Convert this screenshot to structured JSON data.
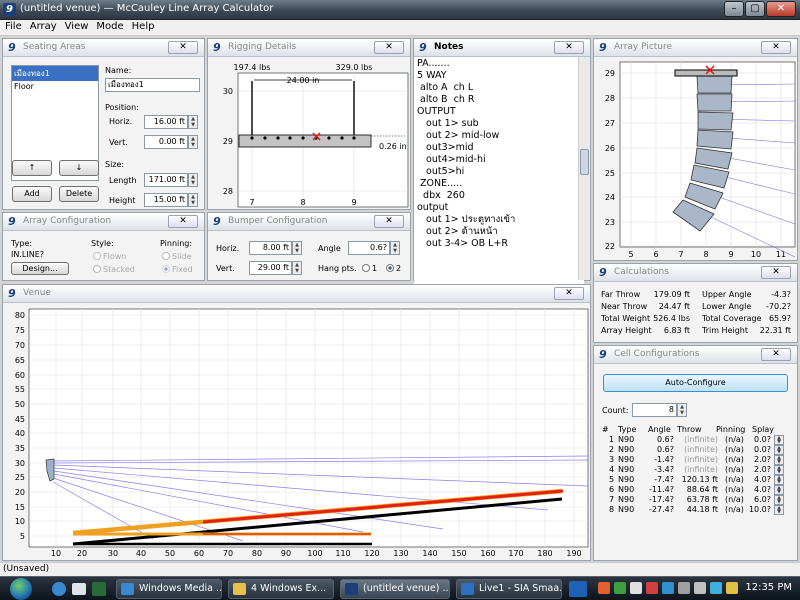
{
  "window": {
    "title": "(untitled venue) — McCauley Line Array Calculator",
    "min_btn": "–",
    "max_btn": "▢",
    "close_btn": "✕"
  },
  "menu": [
    "File",
    "Array",
    "View",
    "Mode",
    "Help"
  ],
  "panel_badge": "9",
  "panel_close": "✕",
  "seating": {
    "title": "Seating Areas",
    "areas": [
      "เมืองทอง1",
      "Floor"
    ],
    "name_label": "Name:",
    "name_value": "เมืองทอง1",
    "position_label": "Position:",
    "horiz_label": "Horiz.",
    "horiz_value": "16.00 ft",
    "vert_label": "Vert.",
    "vert_value": "0.00 ft",
    "size_label": "Size:",
    "length_label": "Length",
    "length_value": "171.00 ft",
    "height_label": "Height",
    "height_value": "15.00 ft",
    "up_label": "↑",
    "down_label": "↓",
    "add_label": "Add",
    "delete_label": "Delete"
  },
  "rigging": {
    "title": "Rigging Details",
    "left_load": "197.4 lbs",
    "right_load": "329.0 lbs",
    "span": "24.00 in",
    "offset": "0.26 in",
    "y_ticks": [
      "30",
      "29",
      "28"
    ],
    "x_ticks": [
      "7",
      "8",
      "9"
    ]
  },
  "notes": {
    "title": "Notes",
    "lines": [
      "PA.......",
      "5 WAY",
      " alto A  ch L",
      " alto B  ch R",
      "",
      "OUTPUT",
      "   out 1> sub",
      "   out 2> mid-low",
      "   out3>mid",
      "   out4>mid-hi",
      "   out5>hi",
      " ZONE.....",
      "  dbx  260",
      "output",
      "   out 1> ประตูทางเข้า",
      "   out 2> ด้านหน้า",
      "   out 3-4> OB L+R"
    ]
  },
  "array_picture": {
    "title": "Array Picture",
    "x_ticks": [
      "5",
      "6",
      "7",
      "8",
      "9",
      "10",
      "11"
    ],
    "y_ticks": [
      "29",
      "28",
      "27",
      "26",
      "25",
      "24",
      "23",
      "22"
    ]
  },
  "array_config": {
    "title": "Array Configuration",
    "type_label": "Type:",
    "type_value": "IN.LINE?",
    "design_label": "Design...",
    "style_label": "Style:",
    "style_options": [
      "Flown",
      "Stacked"
    ],
    "pinning_label": "Pinning:",
    "pinning_options": [
      "Slide",
      "Fixed"
    ]
  },
  "bumper": {
    "title": "Bumper Configuration",
    "horiz_label": "Horiz.",
    "horiz_value": "8.00 ft",
    "vert_label": "Vert.",
    "vert_value": "29.00 ft",
    "angle_label": "Angle",
    "angle_value": "0.6?",
    "hang_label": "Hang pts.",
    "hang_options": [
      "1",
      "2"
    ],
    "hang_selected": "2"
  },
  "calculations": {
    "title": "Calculations",
    "rows": [
      {
        "l1": "Far Throw",
        "v1": "179.09 ft",
        "l2": "Upper Angle",
        "v2": "-4.3?"
      },
      {
        "l1": "Near Throw",
        "v1": "24.47 ft",
        "l2": "Lower Angle",
        "v2": "-70.2?"
      },
      {
        "l1": "Total Weight",
        "v1": "526.4 lbs",
        "l2": "Total Coverage",
        "v2": "65.9?"
      },
      {
        "l1": "Array Height",
        "v1": "6.83 ft",
        "l2": "Trim Height",
        "v2": "22.31 ft"
      }
    ]
  },
  "cell_config": {
    "title": "Cell Configurations",
    "auto_label": "Auto-Configure",
    "count_label": "Count:",
    "count_value": "8",
    "headers": [
      "#",
      "Type",
      "Angle",
      "Throw",
      "Pinning",
      "Splay"
    ],
    "rows": [
      {
        "n": "1",
        "type": "N90",
        "angle": "0.6?",
        "throw": "(infinite)",
        "pin": "(n/a)",
        "splay": "0.0?"
      },
      {
        "n": "2",
        "type": "N90",
        "angle": "0.6?",
        "throw": "(infinite)",
        "pin": "(n/a)",
        "splay": "0.0?"
      },
      {
        "n": "3",
        "type": "N90",
        "angle": "-1.4?",
        "throw": "(infinite)",
        "pin": "(n/a)",
        "splay": "2.0?"
      },
      {
        "n": "4",
        "type": "N90",
        "angle": "-3.4?",
        "throw": "(infinite)",
        "pin": "(n/a)",
        "splay": "2.0?"
      },
      {
        "n": "5",
        "type": "N90",
        "angle": "-7.4?",
        "throw": "120.13 ft",
        "pin": "(n/a)",
        "splay": "4.0?"
      },
      {
        "n": "6",
        "type": "N90",
        "angle": "-11.4?",
        "throw": "88.64 ft",
        "pin": "(n/a)",
        "splay": "4.0?"
      },
      {
        "n": "7",
        "type": "N90",
        "angle": "-17.4?",
        "throw": "63.78 ft",
        "pin": "(n/a)",
        "splay": "6.0?"
      },
      {
        "n": "8",
        "type": "N90",
        "angle": "-27.4?",
        "throw": "44.18 ft",
        "pin": "(n/a)",
        "splay": "10.0?"
      }
    ]
  },
  "venue": {
    "title": "Venue",
    "y_ticks": [
      "80",
      "75",
      "70",
      "65",
      "60",
      "55",
      "50",
      "45",
      "40",
      "35",
      "30",
      "25",
      "20",
      "15",
      "10",
      "5"
    ],
    "x_ticks": [
      "10",
      "20",
      "30",
      "40",
      "50",
      "60",
      "70",
      "80",
      "90",
      "100",
      "110",
      "120",
      "130",
      "140",
      "150",
      "160",
      "170",
      "180",
      "190"
    ]
  },
  "status": "(Unsaved)",
  "taskbar": {
    "tasks": [
      "Windows Media ...",
      "4 Windows Ex...",
      "(untitled venue) ...",
      "Live1 - SIA Smaa..."
    ],
    "clock": "12:35 PM"
  }
}
